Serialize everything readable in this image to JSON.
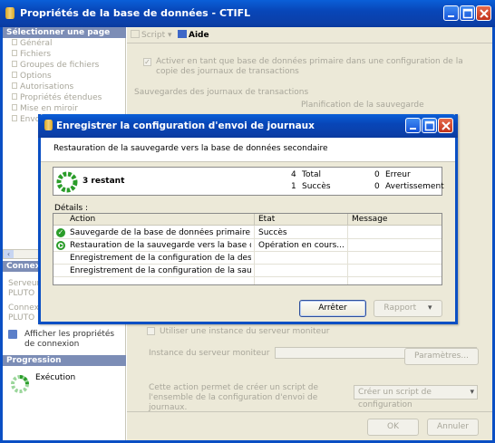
{
  "main_window": {
    "title": "Propriétés de la base de données - CTIFL",
    "toolbar": {
      "script_label": "Script",
      "help_label": "Aide"
    },
    "sidebar": {
      "header": "Sélectionner une page",
      "items": [
        "Général",
        "Fichiers",
        "Groupes de fichiers",
        "Options",
        "Autorisations",
        "Propriétés étendues",
        "Mise en miroir",
        "Envoi"
      ],
      "connection_header": "Connexion",
      "server_label": "Serveur",
      "server_value": "PLUTO",
      "connection_label": "Connexion",
      "connection_value": "PLUTO",
      "view_props_link": "Afficher les propriétés de connexion",
      "progress_header": "Progression",
      "progress_status": "Exécution"
    },
    "content": {
      "enable_checkbox": "Activer en tant que base de données primaire dans une configuration de la copie des journaux de transactions",
      "backups_section": "Sauvegardes des journaux de transactions",
      "backup_schedule": "Planification de la sauvegarde",
      "monitor_checkbox": "Utiliser une instance du serveur moniteur",
      "monitor_instance_label": "Instance du serveur moniteur",
      "params_button": "Paramètres...",
      "script_note": "Cette action permet de créer un script de l'ensemble de la configuration d'envoi de journaux.",
      "create_script_button": "Créer un script de configuration",
      "ok_button": "OK",
      "cancel_button": "Annuler"
    }
  },
  "dialog": {
    "title": "Enregistrer la configuration d'envoi de journaux",
    "subtitle": "Restauration de la sauvegarde vers la base de données secondaire",
    "remaining": "3 restant",
    "stats": {
      "total_value": "4",
      "total_label": "Total",
      "success_value": "1",
      "success_label": "Succès",
      "error_value": "0",
      "error_label": "Erreur",
      "warning_value": "0",
      "warning_label": "Avertissement"
    },
    "details_label": "Détails :",
    "columns": [
      "Action",
      "État",
      "Message"
    ],
    "rows": [
      {
        "action": "Sauvegarde de la base de données primaire [CTIFL]",
        "state": "Succès",
        "message": "",
        "icon": "success-check-icon"
      },
      {
        "action": "Restauration de la sauvegarde vers la base de don...",
        "state": "Opération en cours...",
        "message": "",
        "icon": "in-progress-icon"
      },
      {
        "action": "Enregistrement de la configuration de la destination ...",
        "state": "",
        "message": "",
        "icon": ""
      },
      {
        "action": "Enregistrement de la configuration de la sauvegarde...",
        "state": "",
        "message": "",
        "icon": ""
      }
    ],
    "stop_button": "Arrêter",
    "report_button": "Rapport"
  },
  "colors": {
    "title_bar": "#0a4fc4",
    "sidebar_header": "#7c8db6",
    "panel": "#ece9d8",
    "success": "#2a9d2a"
  }
}
